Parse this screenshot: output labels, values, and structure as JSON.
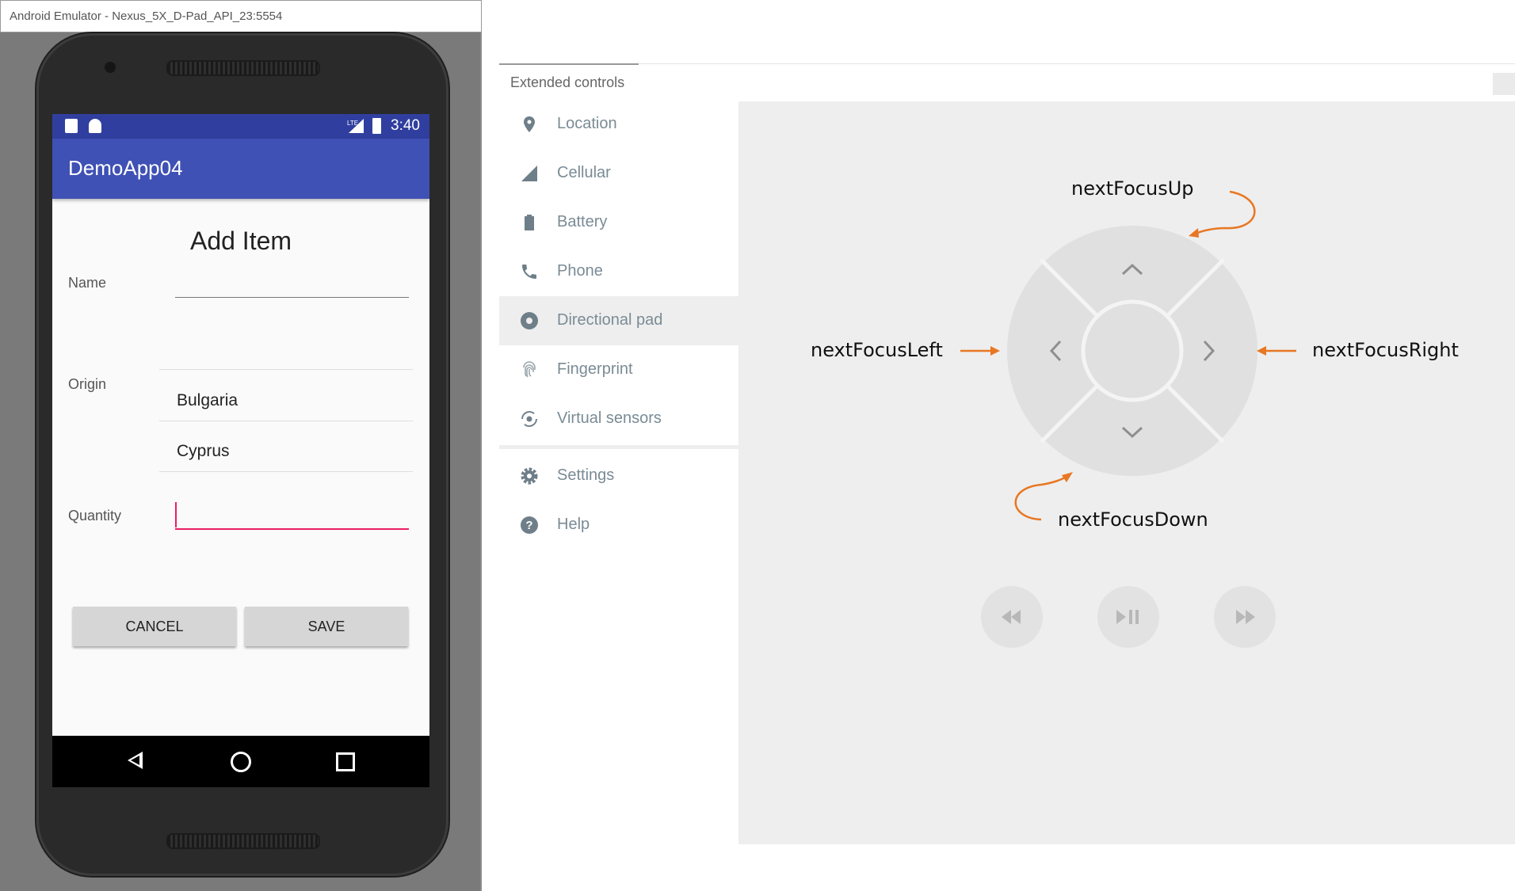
{
  "emulator": {
    "window_title": "Android Emulator - Nexus_5X_D-Pad_API_23:5554",
    "status_bar": {
      "time": "3:40",
      "network": "LTE"
    },
    "app_bar_title": "DemoApp04",
    "form": {
      "title": "Add Item",
      "name_label": "Name",
      "name_value": "",
      "origin_label": "Origin",
      "origin_options": [
        "Bulgaria",
        "Cyprus"
      ],
      "quantity_label": "Quantity",
      "quantity_value": "",
      "cancel_label": "CANCEL",
      "save_label": "SAVE"
    },
    "accent_color": "#3f51b5",
    "focus_color": "#e91e63"
  },
  "extended_controls": {
    "title": "Extended controls",
    "menu": [
      {
        "label": "Location",
        "icon": "location-pin-icon"
      },
      {
        "label": "Cellular",
        "icon": "cellular-signal-icon"
      },
      {
        "label": "Battery",
        "icon": "battery-icon"
      },
      {
        "label": "Phone",
        "icon": "phone-icon"
      },
      {
        "label": "Directional pad",
        "icon": "dpad-icon",
        "active": true
      },
      {
        "label": "Fingerprint",
        "icon": "fingerprint-icon"
      },
      {
        "label": "Virtual sensors",
        "icon": "virtual-sensors-icon"
      }
    ],
    "menu_secondary": [
      {
        "label": "Settings",
        "icon": "gear-icon"
      },
      {
        "label": "Help",
        "icon": "help-icon"
      }
    ],
    "dpad_annotations": {
      "up": "nextFocusUp",
      "left": "nextFocusLeft",
      "right": "nextFocusRight",
      "down": "nextFocusDown"
    },
    "annotation_color": "#e87722",
    "media_buttons": [
      "rewind-icon",
      "play-pause-icon",
      "fast-forward-icon"
    ]
  }
}
